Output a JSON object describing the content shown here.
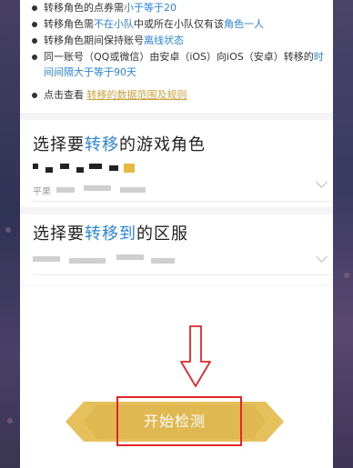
{
  "rules": [
    {
      "parts": [
        {
          "t": "转移角色的点券需"
        },
        {
          "t": "小于等于20",
          "c": "blue"
        }
      ]
    },
    {
      "parts": [
        {
          "t": "转移角色需"
        },
        {
          "t": "不在小队",
          "c": "blue"
        },
        {
          "t": "中或所在小队仅有该"
        },
        {
          "t": "角色一人",
          "c": "blue"
        }
      ]
    },
    {
      "parts": [
        {
          "t": "转移角色期间保持账号"
        },
        {
          "t": "离线状态",
          "c": "blue"
        }
      ]
    },
    {
      "parts": [
        {
          "t": "同一账号（QQ或微信）由安卓（iOS）向iOS（安卓）转移的"
        },
        {
          "t": "时间间隔大于等于90天",
          "c": "blue"
        }
      ]
    }
  ],
  "data_link": {
    "prefix": "点击查看",
    "link": "转移的数据范围及规则"
  },
  "role_section": {
    "title_parts": [
      {
        "t": "选择要"
      },
      {
        "t": "转移",
        "c": "blue"
      },
      {
        "t": "的游戏角色"
      }
    ],
    "sub_prefix": "平果"
  },
  "server_section": {
    "title_parts": [
      {
        "t": "选择要"
      },
      {
        "t": "转移到",
        "c": "blue"
      },
      {
        "t": "的区服"
      }
    ]
  },
  "start_button": {
    "label": "开始检测"
  },
  "colors": {
    "accent": "#2b86d8",
    "button": "#e6c05a",
    "link": "#c9a13a",
    "highlight": "#e0252b"
  }
}
